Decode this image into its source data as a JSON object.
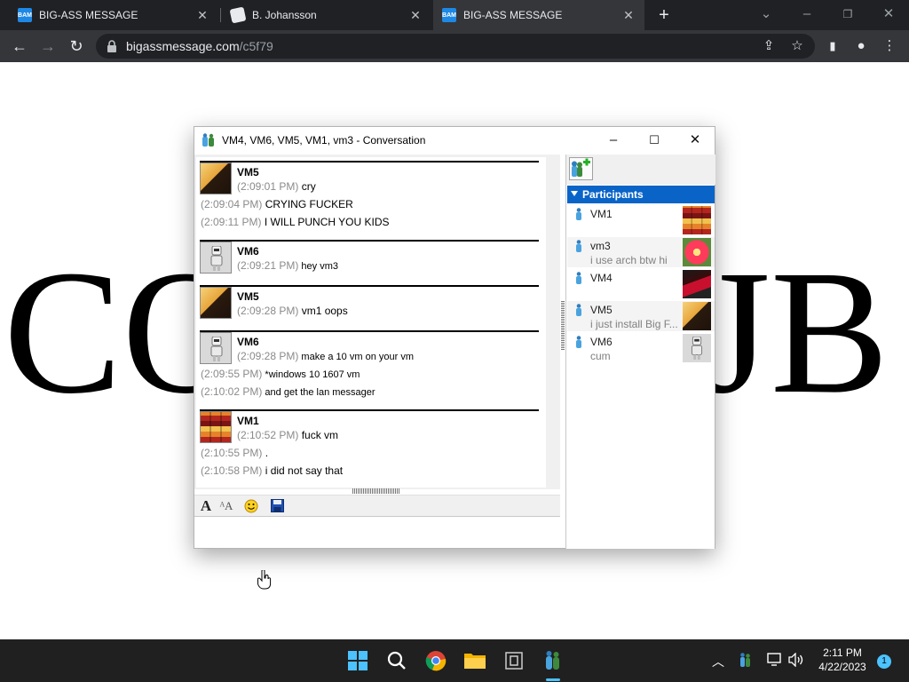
{
  "browser": {
    "tabs": [
      {
        "label": "BIG-ASS MESSAGE",
        "favicon": "BAM"
      },
      {
        "label": "B. Johansson",
        "favicon": "doc"
      },
      {
        "label": "BIG-ASS MESSAGE",
        "favicon": "BAM"
      }
    ],
    "url_host": "bigassmessage.com",
    "url_path": "/c5f79"
  },
  "page": {
    "bg_left": "CO",
    "bg_right": "JB"
  },
  "window": {
    "title": "VM4, VM6, VM5, VM1, vm3 - Conversation"
  },
  "messages": [
    {
      "sender": "VM5",
      "avatar": "bass",
      "lines": [
        {
          "ts": "(2:09:01 PM)",
          "text": " cry"
        },
        {
          "ts": "(2:09:04 PM)",
          "text": " CRYING FUCKER"
        },
        {
          "ts": "(2:09:11 PM)",
          "text": " I WILL PUNCH YOU KIDS"
        }
      ]
    },
    {
      "sender": "VM6",
      "avatar": "robot",
      "lines": [
        {
          "ts": "(2:09:21 PM)",
          "text": " hey vm3"
        }
      ]
    },
    {
      "sender": "VM5",
      "avatar": "bass",
      "lines": [
        {
          "ts": "(2:09:28 PM)",
          "text": " vm1 oops"
        }
      ]
    },
    {
      "sender": "VM6",
      "avatar": "robot",
      "lines": [
        {
          "ts": "(2:09:28 PM)",
          "text": " make a 10 vm on your vm"
        },
        {
          "ts": "(2:09:55 PM)",
          "text": " *windows 10 1607 vm"
        },
        {
          "ts": "(2:10:02 PM)",
          "text": " and get the lan messager"
        }
      ]
    },
    {
      "sender": "VM1",
      "avatar": "quilt",
      "lines": [
        {
          "ts": "(2:10:52 PM)",
          "text": " fuck vm"
        },
        {
          "ts": "(2:10:55 PM)",
          "text": " ."
        },
        {
          "ts": "(2:10:58 PM)",
          "text": " i did not say that"
        }
      ]
    }
  ],
  "participants": {
    "header": "Participants",
    "list": [
      {
        "name": "VM1",
        "status": "",
        "avatar": "quilt"
      },
      {
        "name": "vm3",
        "status": "i use arch btw hi",
        "avatar": "flower"
      },
      {
        "name": "VM4",
        "status": "",
        "avatar": "crane"
      },
      {
        "name": "VM5",
        "status": "i just install Big F...",
        "avatar": "bass"
      },
      {
        "name": "VM6",
        "status": "cum",
        "avatar": "robot"
      }
    ]
  },
  "taskbar": {
    "time": "2:11 PM",
    "date": "4/22/2023",
    "notifications": "1"
  },
  "colors": {
    "accent": "#0a64c8",
    "timestamp": "#8a8a8a",
    "taskbar": "#202020",
    "chrome_dark": "#202124"
  }
}
